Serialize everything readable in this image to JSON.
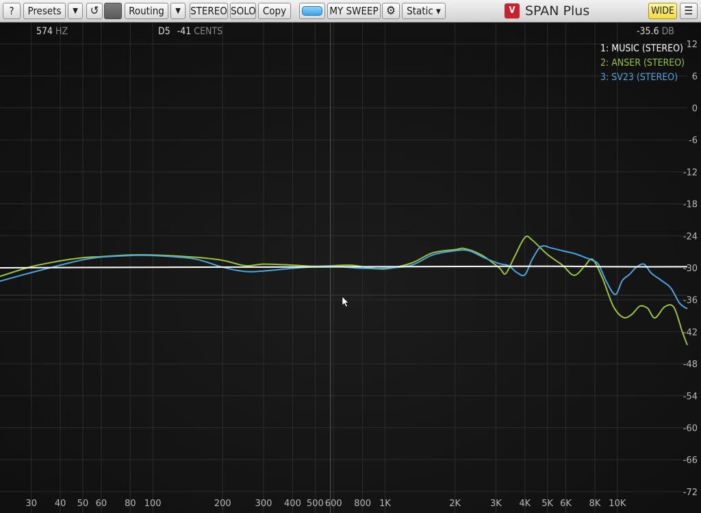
{
  "toolbar": {
    "help": "?",
    "presets": "Presets",
    "presets_arrow": "▼",
    "undo_icon": "↺",
    "routing": "Routing",
    "routing_arrow": "▼",
    "stereo": "STEREO",
    "solo": "SOLO",
    "copy": "Copy",
    "sweep": "MY SWEEP",
    "gear_icon": "⚙",
    "mode": "Static ▾",
    "logo_glyph": "V",
    "product": "SPAN Plus",
    "wide": "WIDE",
    "menu_icon": "☰"
  },
  "readouts": {
    "freq_value": "574",
    "freq_unit": "HZ",
    "note": "D5",
    "cents_value": "-41",
    "cents_unit": "CENTS",
    "level_value": "-35.6",
    "level_unit": "DB"
  },
  "colors": {
    "music": "#ffffff",
    "anser": "#9cc43a",
    "sv23": "#4aa6e0",
    "grid": "#2c2c2c",
    "axis_text": "#b8b8b8"
  },
  "chart_data": {
    "type": "line",
    "x_scale": "log",
    "x_range": [
      22,
      20000
    ],
    "y_range": [
      -76,
      16
    ],
    "grid": true,
    "legend_position": "top-right",
    "x_ticks": [
      {
        "v": 30,
        "label": "30"
      },
      {
        "v": 40,
        "label": "40"
      },
      {
        "v": 50,
        "label": "50"
      },
      {
        "v": 60,
        "label": "60"
      },
      {
        "v": 80,
        "label": "80"
      },
      {
        "v": 100,
        "label": "100"
      },
      {
        "v": 200,
        "label": "200"
      },
      {
        "v": 300,
        "label": "300"
      },
      {
        "v": 400,
        "label": "400"
      },
      {
        "v": 500,
        "label": "500"
      },
      {
        "v": 600,
        "label": "600"
      },
      {
        "v": 800,
        "label": "800"
      },
      {
        "v": 1000,
        "label": "1K"
      },
      {
        "v": 2000,
        "label": "2K"
      },
      {
        "v": 3000,
        "label": "3K"
      },
      {
        "v": 4000,
        "label": "4K"
      },
      {
        "v": 5000,
        "label": "5K"
      },
      {
        "v": 6000,
        "label": "6K"
      },
      {
        "v": 8000,
        "label": "8K"
      },
      {
        "v": 10000,
        "label": "10K"
      }
    ],
    "y_ticks": [
      12,
      6,
      0,
      -6,
      -12,
      -18,
      -24,
      -30,
      -36,
      -42,
      -48,
      -54,
      -60,
      -66,
      -72
    ],
    "cursor_freq_hz": 574,
    "series": [
      {
        "name": "1: MUSIC (STEREO)",
        "color_key": "music",
        "points": [
          [
            22,
            -30.0
          ],
          [
            100,
            -29.9
          ],
          [
            1000,
            -29.8
          ],
          [
            5000,
            -29.7
          ],
          [
            10000,
            -29.8
          ],
          [
            20000,
            -29.8
          ]
        ]
      },
      {
        "name": "2: ANSER (STEREO)",
        "color_key": "anser",
        "points": [
          [
            22,
            -31.6
          ],
          [
            30,
            -29.8
          ],
          [
            40,
            -28.7
          ],
          [
            50,
            -28.1
          ],
          [
            60,
            -27.9
          ],
          [
            80,
            -27.6
          ],
          [
            100,
            -27.6
          ],
          [
            150,
            -28.0
          ],
          [
            200,
            -28.6
          ],
          [
            250,
            -29.6
          ],
          [
            300,
            -29.3
          ],
          [
            400,
            -29.5
          ],
          [
            500,
            -29.7
          ],
          [
            700,
            -29.5
          ],
          [
            800,
            -29.8
          ],
          [
            1000,
            -30.2
          ],
          [
            1300,
            -29.1
          ],
          [
            1600,
            -27.2
          ],
          [
            2000,
            -26.6
          ],
          [
            2200,
            -26.4
          ],
          [
            2600,
            -27.6
          ],
          [
            3100,
            -30.0
          ],
          [
            3300,
            -31.1
          ],
          [
            3600,
            -28.0
          ],
          [
            4000,
            -24.3
          ],
          [
            4300,
            -24.8
          ],
          [
            5000,
            -27.5
          ],
          [
            5800,
            -29.5
          ],
          [
            6500,
            -31.4
          ],
          [
            7200,
            -29.8
          ],
          [
            7800,
            -28.4
          ],
          [
            8600,
            -31.8
          ],
          [
            9600,
            -37.2
          ],
          [
            10600,
            -39.3
          ],
          [
            11500,
            -38.8
          ],
          [
            12500,
            -37.2
          ],
          [
            13500,
            -37.6
          ],
          [
            14500,
            -39.4
          ],
          [
            16000,
            -37.3
          ],
          [
            17500,
            -37.4
          ],
          [
            19000,
            -41.9
          ],
          [
            20000,
            -44.5
          ]
        ]
      },
      {
        "name": "3: SV23 (STEREO)",
        "color_key": "sv23",
        "points": [
          [
            22,
            -32.5
          ],
          [
            30,
            -30.9
          ],
          [
            40,
            -29.5
          ],
          [
            50,
            -28.5
          ],
          [
            60,
            -28.0
          ],
          [
            80,
            -27.7
          ],
          [
            100,
            -27.7
          ],
          [
            150,
            -28.3
          ],
          [
            200,
            -29.9
          ],
          [
            250,
            -30.7
          ],
          [
            300,
            -30.6
          ],
          [
            400,
            -30.1
          ],
          [
            500,
            -29.8
          ],
          [
            600,
            -29.7
          ],
          [
            800,
            -30.1
          ],
          [
            1000,
            -30.1
          ],
          [
            1300,
            -29.5
          ],
          [
            1600,
            -27.6
          ],
          [
            2000,
            -26.8
          ],
          [
            2300,
            -26.8
          ],
          [
            2700,
            -28.2
          ],
          [
            3100,
            -29.2
          ],
          [
            3400,
            -29.6
          ],
          [
            3700,
            -30.9
          ],
          [
            4000,
            -31.3
          ],
          [
            4300,
            -28.4
          ],
          [
            4700,
            -26.0
          ],
          [
            5200,
            -26.3
          ],
          [
            5800,
            -26.8
          ],
          [
            6500,
            -27.3
          ],
          [
            7200,
            -28.0
          ],
          [
            7800,
            -28.6
          ],
          [
            8300,
            -29.4
          ],
          [
            9000,
            -32.7
          ],
          [
            9800,
            -35.0
          ],
          [
            10500,
            -32.4
          ],
          [
            11300,
            -31.2
          ],
          [
            12000,
            -30.0
          ],
          [
            13000,
            -29.3
          ],
          [
            14000,
            -31.0
          ],
          [
            15500,
            -32.4
          ],
          [
            17000,
            -33.8
          ],
          [
            18500,
            -36.6
          ],
          [
            20000,
            -37.7
          ]
        ]
      }
    ]
  }
}
